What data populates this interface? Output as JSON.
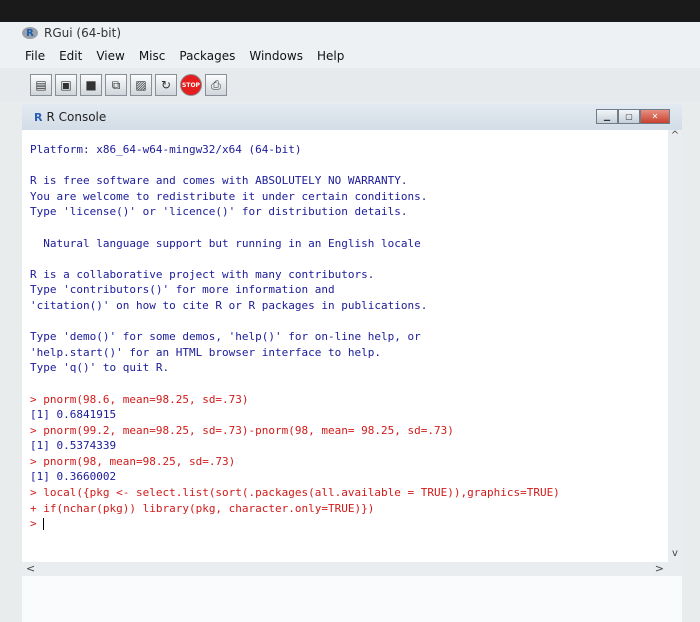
{
  "app": {
    "title": "RGui (64-bit)",
    "logo_letter": "R"
  },
  "menu": [
    "File",
    "Edit",
    "View",
    "Misc",
    "Packages",
    "Windows",
    "Help"
  ],
  "toolbar": {
    "buttons": [
      {
        "name": "open-script-button",
        "icon": "▤"
      },
      {
        "name": "load-workspace-button",
        "icon": "▣"
      },
      {
        "name": "save-button",
        "icon": "■"
      },
      {
        "name": "copy-button",
        "icon": "⧉"
      },
      {
        "name": "paste-button",
        "icon": "▨"
      },
      {
        "name": "copy-paste-button",
        "icon": "↻"
      },
      {
        "name": "stop-button",
        "icon": "STOP"
      },
      {
        "name": "print-button",
        "icon": "⎙"
      }
    ]
  },
  "console": {
    "title": "R Console",
    "icon_letter": "R",
    "lines": [
      {
        "t": "Platform: x86_64-w64-mingw32/x64 (64-bit)",
        "k": "out"
      },
      {
        "t": "",
        "k": "out"
      },
      {
        "t": "R is free software and comes with ABSOLUTELY NO WARRANTY.",
        "k": "out"
      },
      {
        "t": "You are welcome to redistribute it under certain conditions.",
        "k": "out"
      },
      {
        "t": "Type 'license()' or 'licence()' for distribution details.",
        "k": "out"
      },
      {
        "t": "",
        "k": "out"
      },
      {
        "t": "  Natural language support but running in an English locale",
        "k": "out"
      },
      {
        "t": "",
        "k": "out"
      },
      {
        "t": "R is a collaborative project with many contributors.",
        "k": "out"
      },
      {
        "t": "Type 'contributors()' for more information and",
        "k": "out"
      },
      {
        "t": "'citation()' on how to cite R or R packages in publications.",
        "k": "out"
      },
      {
        "t": "",
        "k": "out"
      },
      {
        "t": "Type 'demo()' for some demos, 'help()' for on-line help, or",
        "k": "out"
      },
      {
        "t": "'help.start()' for an HTML browser interface to help.",
        "k": "out"
      },
      {
        "t": "Type 'q()' to quit R.",
        "k": "out"
      },
      {
        "t": "",
        "k": "out"
      },
      {
        "p": "> ",
        "t": "pnorm(98.6, mean=98.25, sd=.73)",
        "k": "cmd"
      },
      {
        "t": "[1] 0.6841915",
        "k": "out"
      },
      {
        "p": "> ",
        "t": "pnorm(99.2, mean=98.25, sd=.73)-pnorm(98, mean= 98.25, sd=.73)",
        "k": "cmd"
      },
      {
        "t": "[1] 0.5374339",
        "k": "out"
      },
      {
        "p": "> ",
        "t": "pnorm(98, mean=98.25, sd=.73)",
        "k": "cmd"
      },
      {
        "t": "[1] 0.3660002",
        "k": "out"
      },
      {
        "p": "> ",
        "t": "local({pkg <- select.list(sort(.packages(all.available = TRUE)),graphics=TRUE)",
        "k": "cmd"
      },
      {
        "p": "+ ",
        "t": "if(nchar(pkg)) library(pkg, character.only=TRUE)})",
        "k": "cmd"
      },
      {
        "p": "> ",
        "t": "",
        "k": "caret"
      }
    ]
  },
  "scroll": {
    "up": "^",
    "down": "v",
    "left": "<",
    "right": ">"
  }
}
